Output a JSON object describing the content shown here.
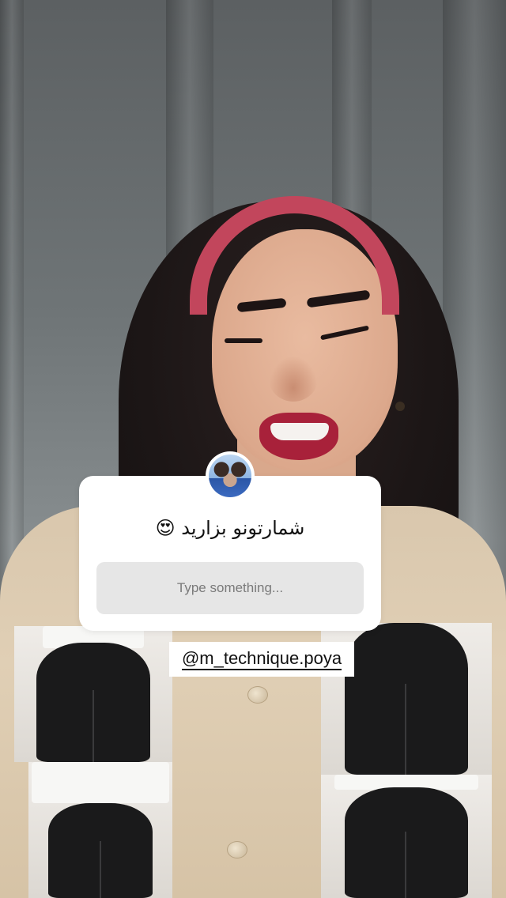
{
  "question_sticker": {
    "prompt": "شمارتونو بزارید 😍",
    "placeholder": "Type something..."
  },
  "mention": {
    "handle": "@m_technique.poya"
  },
  "colors": {
    "headband": "#c2465c",
    "sticker_bg": "#ffffff",
    "input_bg": "#e6e6e6"
  }
}
